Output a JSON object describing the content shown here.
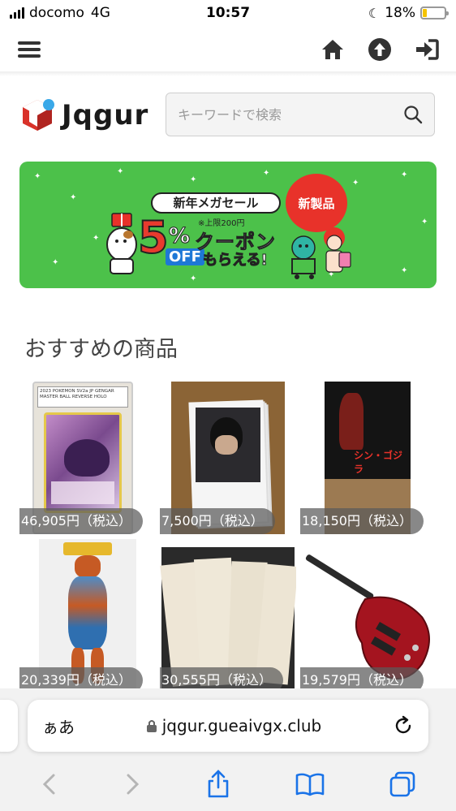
{
  "status_bar": {
    "carrier": "docomo",
    "network": "4G",
    "time": "10:57",
    "battery": "18%",
    "battery_level": 0.18
  },
  "nav": {
    "icons": [
      "menu-icon",
      "home-icon",
      "upload-icon",
      "login-icon"
    ]
  },
  "header": {
    "logo_text": "Jqgur",
    "search_placeholder": "キーワードで検索"
  },
  "banner": {
    "tag": "新年メガセール",
    "note": "※上限200円",
    "big_number": "5",
    "percent": "%",
    "off": "OFF",
    "coupon": "クーポン",
    "moraeru": "もらえる!",
    "badge": "新製品",
    "colors": {
      "background": "#4cc14a",
      "badge": "#e8322a",
      "accent": "#e83a2e"
    }
  },
  "section": {
    "title": "おすすめの商品"
  },
  "products": [
    {
      "price": "46,905円（税込）",
      "image": "pokemon-card-slab",
      "slab_text": "2023 POKEMON SV2a JP GENGAR MASTER BALL REVERSE HOLO"
    },
    {
      "price": "7,500円（税込）",
      "image": "photo-stack"
    },
    {
      "price": "18,150円（税込）",
      "image": "godzilla-box",
      "box_text": "シン・ゴジラ"
    },
    {
      "price": "20,339円（税込）",
      "image": "vinyl-figure"
    },
    {
      "price": "30,555円（税込）",
      "image": "sketch-sheets"
    },
    {
      "price": "19,579円（税込）",
      "image": "red-electric-guitar"
    }
  ],
  "browser": {
    "aa_label": "ぁあ",
    "url": "jqgur.gueaivgx.club"
  }
}
